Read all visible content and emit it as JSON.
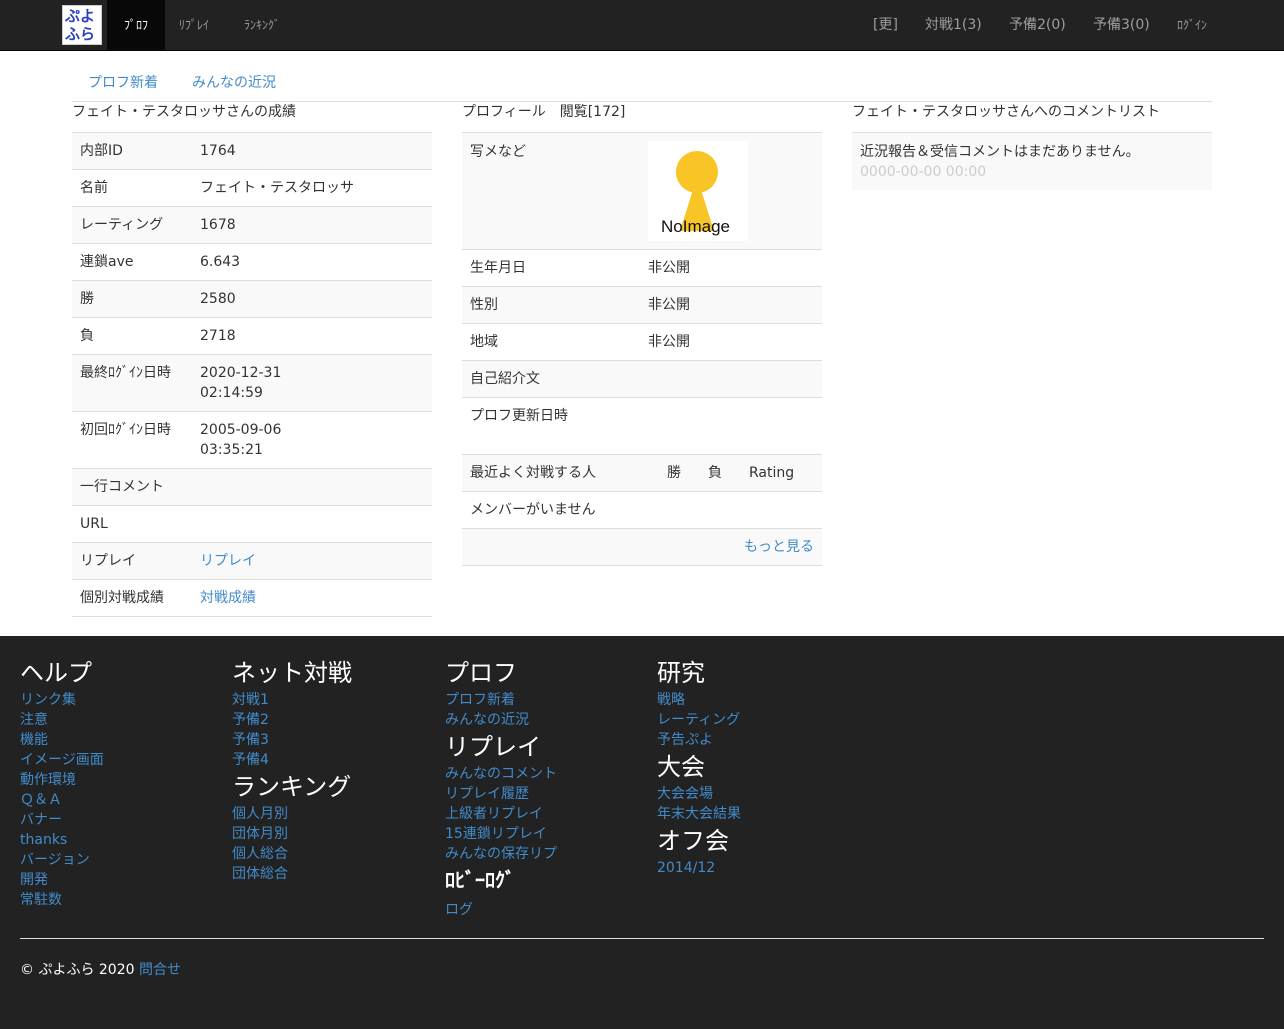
{
  "nav": {
    "logo_line1": "ぷよ",
    "logo_line2": "ふら",
    "left": [
      "ﾌﾟﾛﾌ",
      "ﾘﾌﾟﾚｲ",
      "ﾗﾝｷﾝｸﾞ"
    ],
    "right": [
      "[更]",
      "対戦1(3)",
      "予備2(0)",
      "予備3(0)",
      "ﾛｸﾞｲﾝ"
    ]
  },
  "subnav": [
    "プロフ新着",
    "みんなの近況"
  ],
  "stats": {
    "title": "フェイト・テスタロッサさんの成績",
    "rows": [
      {
        "label": "内部ID",
        "value": "1764"
      },
      {
        "label": "名前",
        "value": "フェイト・テスタロッサ"
      },
      {
        "label": "レーティング",
        "value": "1678"
      },
      {
        "label": "連鎖ave",
        "value": "6.643"
      },
      {
        "label": "勝",
        "value": "2580"
      },
      {
        "label": "負",
        "value": "2718"
      },
      {
        "label": "最終ﾛｸﾞｲﾝ日時",
        "value": "2020-12-31",
        "value2": "02:14:59"
      },
      {
        "label": "初回ﾛｸﾞｲﾝ日時",
        "value": "2005-09-06",
        "value2": "03:35:21"
      },
      {
        "label": "一行コメント",
        "value": ""
      },
      {
        "label": "URL",
        "value": ""
      },
      {
        "label": "リプレイ",
        "value": "リプレイ",
        "link": true
      },
      {
        "label": "個別対戦成績",
        "value": "対戦成績",
        "link": true
      }
    ]
  },
  "profile": {
    "title": "プロフィール　閲覧[172]",
    "photo_label": "写メなど",
    "noimage_text": "NoImage",
    "rows": [
      {
        "label": "生年月日",
        "value": "非公開"
      },
      {
        "label": "性別",
        "value": "非公開"
      },
      {
        "label": "地域",
        "value": "非公開"
      },
      {
        "label": "自己紹介文",
        "value": ""
      },
      {
        "label": "プロフ更新日時",
        "value": ""
      }
    ],
    "opp_headers": [
      "最近よく対戦する人",
      "勝",
      "負",
      "Rating"
    ],
    "no_members": "メンバーがいません",
    "more": "もっと見る"
  },
  "comments": {
    "title": "フェイト・テスタロッサさんへのコメントリスト",
    "empty": "近況報告＆受信コメントはまだありません。",
    "date": "0000-00-00 00:00"
  },
  "footer": {
    "cols": [
      [
        {
          "h": "ヘルプ",
          "links": [
            "リンク集",
            "注意",
            "機能",
            "イメージ画面",
            "動作環境",
            "Ｑ＆Ａ",
            "バナー",
            "thanks",
            "バージョン",
            "開発",
            "常駐数"
          ]
        }
      ],
      [
        {
          "h": "ネット対戦",
          "links": [
            "対戦1",
            "予備2",
            "予備3",
            "予備4"
          ]
        },
        {
          "h": "ランキング",
          "links": [
            "個人月別",
            "団体月別",
            "個人総合",
            "団体総合"
          ]
        }
      ],
      [
        {
          "h": "プロフ",
          "links": [
            "プロフ新着",
            "みんなの近況"
          ]
        },
        {
          "h": "リプレイ",
          "links": [
            "みんなのコメント",
            "リプレイ履歴",
            "上級者リプレイ",
            "15連鎖リプレイ",
            "みんなの保存リプ"
          ]
        },
        {
          "h": "ﾛﾋﾞｰﾛｸﾞ",
          "links": [
            "ログ"
          ]
        }
      ],
      [
        {
          "h": "研究",
          "links": [
            "戦略",
            "レーティング",
            "予告ぷよ"
          ]
        },
        {
          "h": "大会",
          "links": [
            "大会会場",
            "年末大会結果"
          ]
        },
        {
          "h": "オフ会",
          "links": [
            "2014/12"
          ]
        }
      ]
    ],
    "copyright": "© ぷよふら 2020",
    "contact": "問合せ"
  }
}
